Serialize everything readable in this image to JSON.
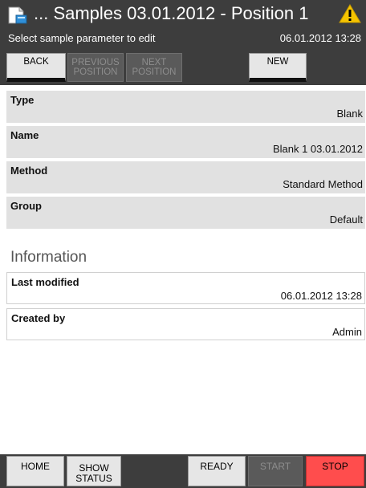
{
  "header": {
    "title": "... Samples 03.01.2012 - Position 1",
    "subtitle": "Select sample parameter to edit",
    "datetime": "06.01.2012 13:28"
  },
  "toolbar": {
    "back_label": "BACK",
    "previous_line1": "PREVIOUS",
    "previous_line2": "POSITION",
    "next_line1": "NEXT",
    "next_line2": "POSITION",
    "new_label": "NEW"
  },
  "params": [
    {
      "label": "Type",
      "value": "Blank"
    },
    {
      "label": "Name",
      "value": "Blank 1 03.01.2012"
    },
    {
      "label": "Method",
      "value": "Standard Method"
    },
    {
      "label": "Group",
      "value": "Default"
    }
  ],
  "information": {
    "title": "Information",
    "rows": [
      {
        "label": "Last modified",
        "value": "06.01.2012 13:28"
      },
      {
        "label": "Created by",
        "value": "Admin"
      }
    ]
  },
  "bottombar": {
    "home_label": "HOME",
    "show_line1": "SHOW",
    "show_line2": "STATUS",
    "ready_label": "READY",
    "start_label": "START",
    "stop_label": "STOP"
  },
  "colors": {
    "bar_background": "#3d3d3d",
    "row_background": "#e1e1e1",
    "stop_button": "#ff4d4d",
    "warning": "#f5c400"
  }
}
